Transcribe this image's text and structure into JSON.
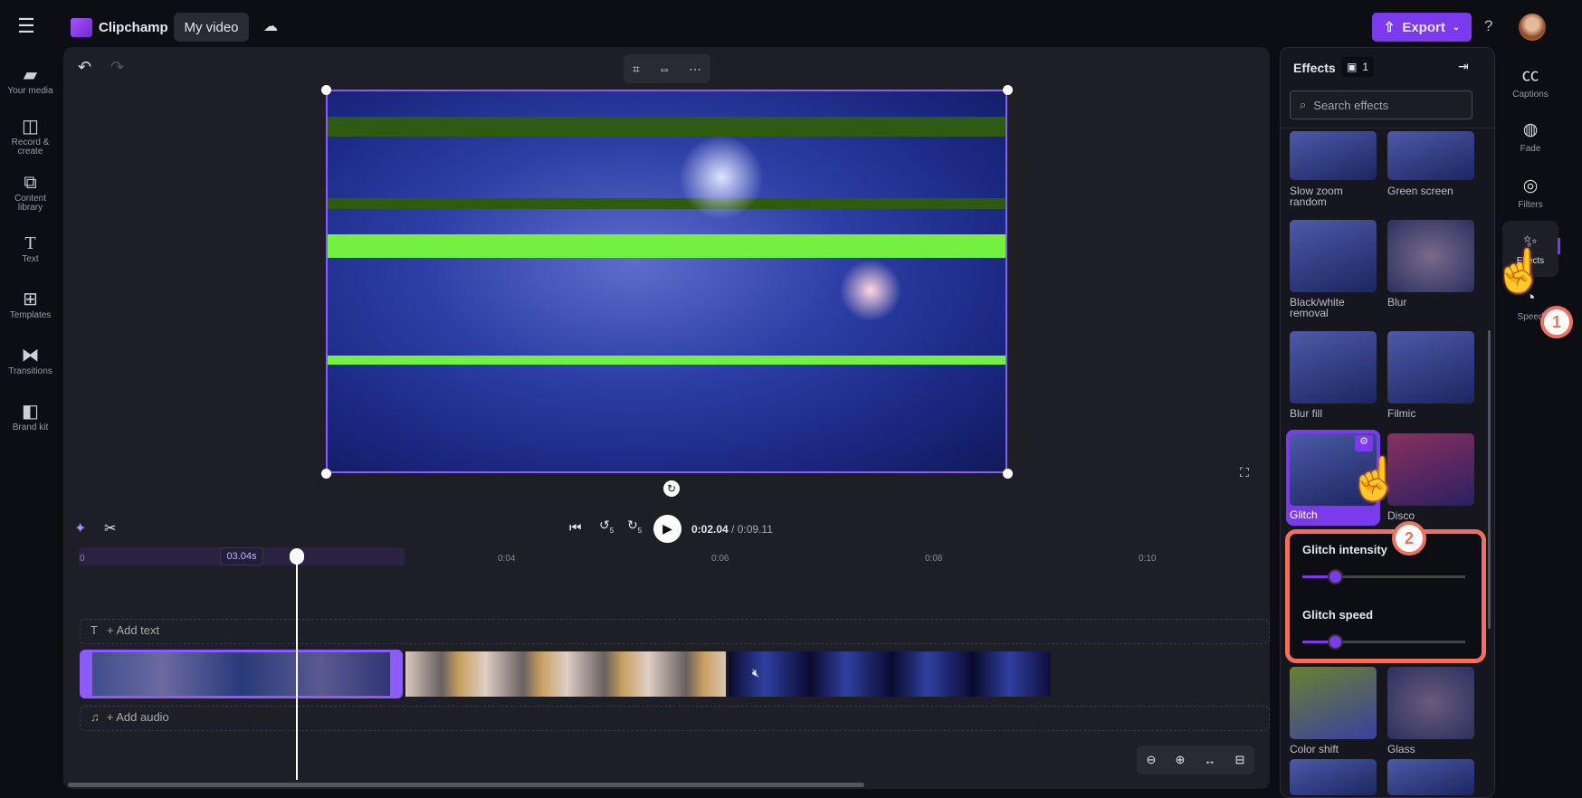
{
  "app": {
    "name": "Clipchamp",
    "project_title": "My video",
    "export_label": "Export",
    "help": "?"
  },
  "sidebar": {
    "items": [
      {
        "label": "Your media",
        "icon": "folder-icon"
      },
      {
        "label": "Record & create",
        "icon": "camera-icon"
      },
      {
        "label": "Content library",
        "icon": "library-icon"
      },
      {
        "label": "Text",
        "icon": "text-icon"
      },
      {
        "label": "Templates",
        "icon": "templates-icon"
      },
      {
        "label": "Transitions",
        "icon": "transitions-icon"
      },
      {
        "label": "Brand kit",
        "icon": "brand-kit-icon"
      }
    ]
  },
  "right_rail": {
    "items": [
      {
        "label": "Captions"
      },
      {
        "label": "Fade"
      },
      {
        "label": "Filters"
      },
      {
        "label": "Effects"
      },
      {
        "label": "Speed"
      }
    ]
  },
  "effects_panel": {
    "title": "Effects",
    "count": "1",
    "search_placeholder": "Search effects",
    "items": [
      "Slow zoom random",
      "Green screen",
      "Black/white removal",
      "Blur",
      "Blur fill",
      "Filmic",
      "Glitch",
      "Disco",
      "Color shift",
      "Glass"
    ],
    "selected": "Glitch",
    "sliders": [
      {
        "label": "Glitch intensity",
        "value": 0.2
      },
      {
        "label": "Glitch speed",
        "value": 0.2
      }
    ]
  },
  "playback": {
    "current": "0:02.04",
    "total": "/ 0:09.11",
    "skip_back": "5",
    "skip_fwd": "5"
  },
  "timeline": {
    "ticks": [
      "0",
      "0:04",
      "0:06",
      "0:08",
      "0:10"
    ],
    "clip_duration": "03.04s",
    "add_text": "+ Add text",
    "add_audio": "+ Add audio"
  },
  "annotations": {
    "step1": "1",
    "step2": "2"
  },
  "colors": {
    "accent": "#7c3aed",
    "highlight": "#f07060"
  }
}
